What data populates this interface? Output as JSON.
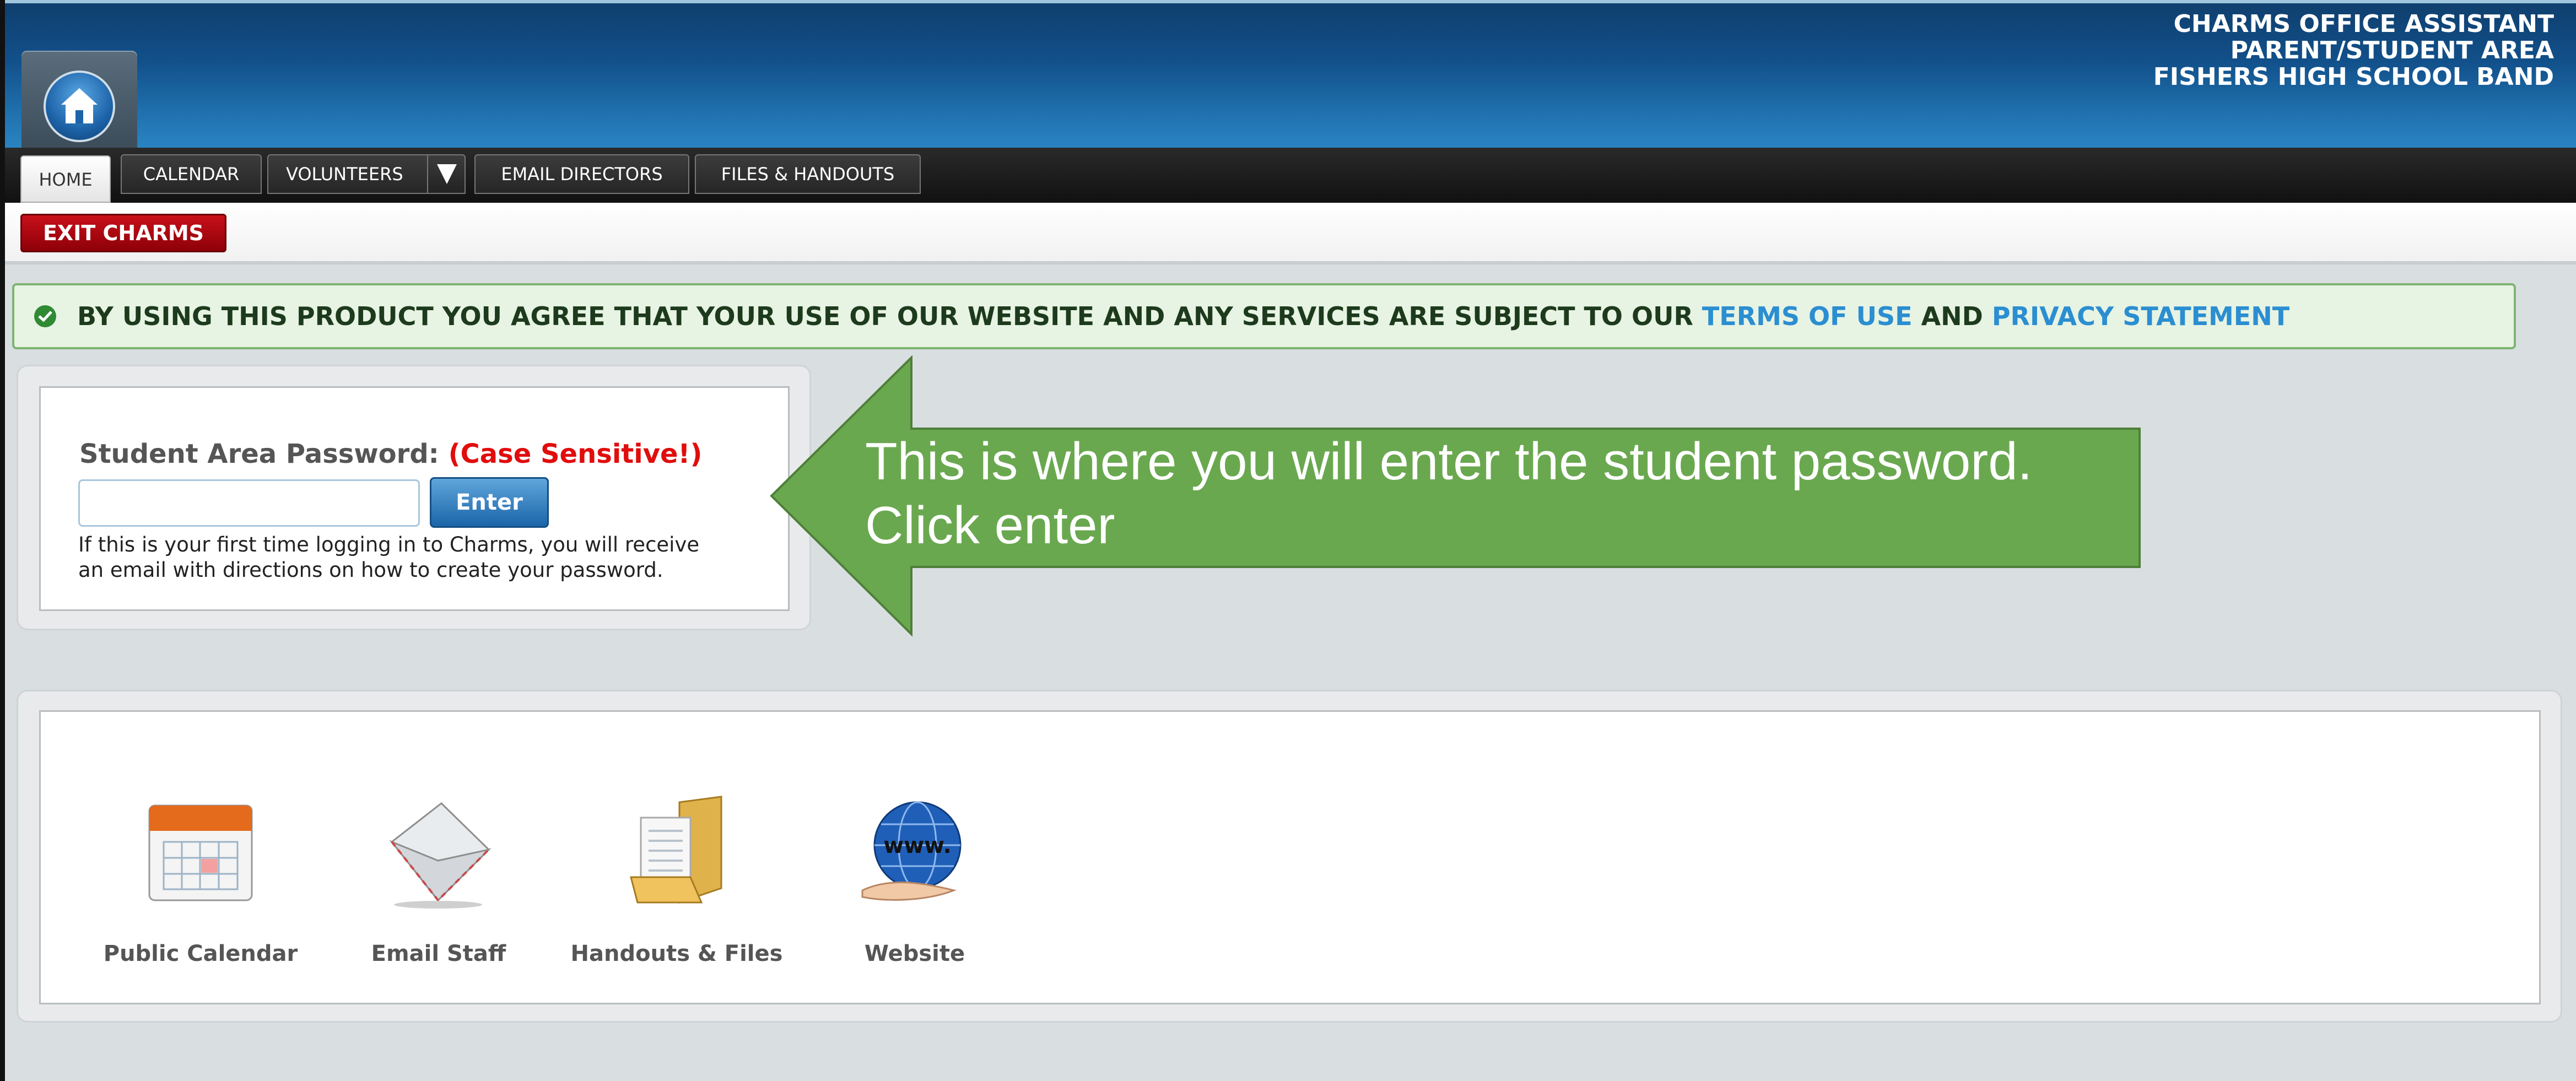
{
  "header": {
    "line1": "CHARMS OFFICE ASSISTANT",
    "line2": "PARENT/STUDENT AREA",
    "line3": "FISHERS HIGH SCHOOL BAND",
    "home_icon": "home-icon"
  },
  "nav": {
    "tabs": [
      {
        "label": "HOME"
      },
      {
        "label": "CALENDAR"
      },
      {
        "label": "VOLUNTEERS"
      },
      {
        "label": "EMAIL DIRECTORS"
      },
      {
        "label": "FILES & HANDOUTS"
      }
    ],
    "active_tab": "HOME"
  },
  "subbar": {
    "exit_label": "EXIT CHARMS"
  },
  "agreement": {
    "prefix": "BY USING THIS PRODUCT YOU AGREE THAT YOUR USE OF OUR WEBSITE AND ANY SERVICES ARE SUBJECT TO OUR",
    "terms_link": "TERMS OF USE",
    "conjunction": "AND",
    "privacy_link": "PRIVACY STATEMENT"
  },
  "login": {
    "label": "Student Area Password:",
    "warning": "(Case Sensitive!)",
    "password_value": "",
    "enter_label": "Enter",
    "help_line1": "If this is your first time logging in to Charms, you will receive",
    "help_line2": "an email with directions on how to create your password."
  },
  "callout": {
    "line1": "This is where you will enter the student password.",
    "line2": "Click enter",
    "color": "#6aa84f"
  },
  "quick_links": [
    {
      "label": "Public Calendar",
      "icon": "calendar-icon"
    },
    {
      "label": "Email Staff",
      "icon": "envelope-icon"
    },
    {
      "label": "Handouts & Files",
      "icon": "folder-icon"
    },
    {
      "label": "Website",
      "icon": "globe-icon"
    }
  ],
  "colors": {
    "header_blue": "#12508a",
    "exit_red": "#b00010",
    "warning_red": "#e10d0d",
    "link_blue": "#2b8ed1",
    "agree_green": "#7db572"
  }
}
